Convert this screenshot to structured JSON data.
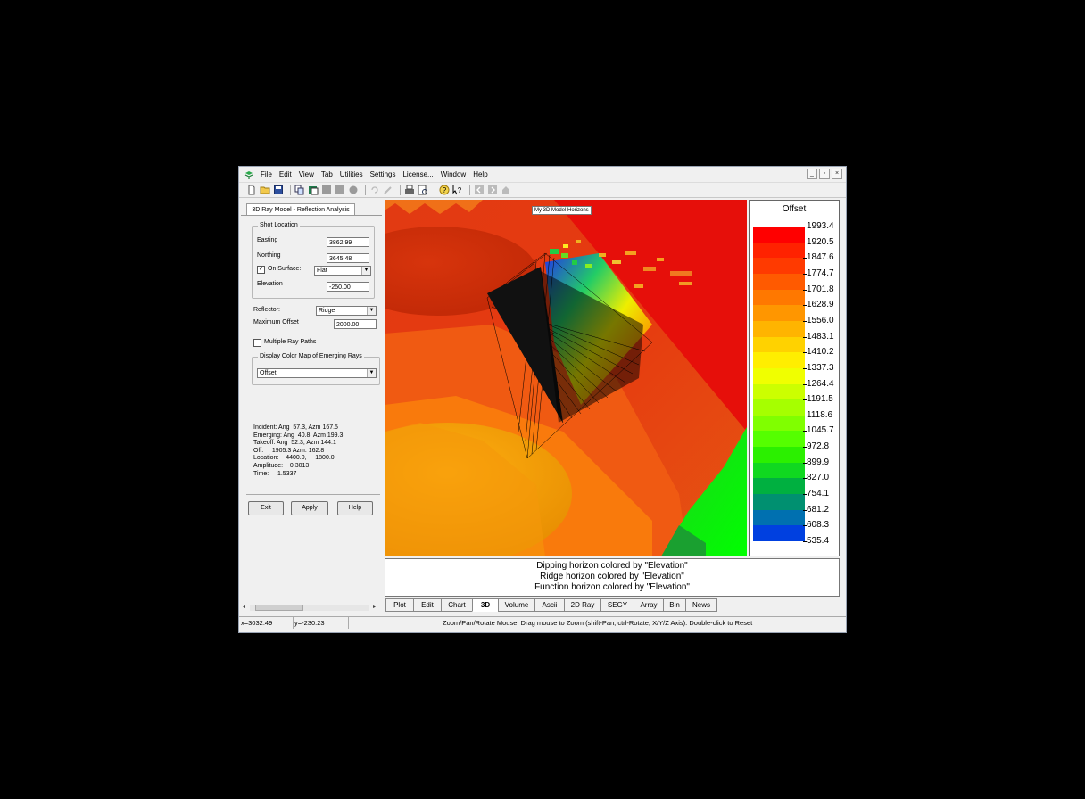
{
  "menu": [
    "File",
    "Edit",
    "View",
    "Tab",
    "Utilities",
    "Settings",
    "License...",
    "Window",
    "Help"
  ],
  "window_controls": [
    "_",
    "▫",
    "×"
  ],
  "panel": {
    "tab_label": "3D Ray Model - Reflection Analysis",
    "shot_group_title": "Shot Location",
    "easting_label": "Easting",
    "easting_value": "3862.99",
    "northing_label": "Northing",
    "northing_value": "3645.48",
    "on_surface_label": "On Surface:",
    "on_surface_checked": "✓",
    "on_surface_value": "Flat",
    "elevation_label": "Elevation",
    "elevation_value": "-250.00",
    "reflector_label": "Reflector:",
    "reflector_value": "Ridge",
    "max_offset_label": "Maximum Offset",
    "max_offset_value": "2000.00",
    "multiple_ray_label": "Multiple Ray Paths",
    "color_map_group_title": "Display Color Map of Emerging Rays",
    "color_map_value": "Offset",
    "info_lines": [
      "Incident: Ang  57.3, Azm 167.5",
      "Emerging: Ang  40.8, Azm 199.3",
      "Takeoff: Ang  52.3, Azm 144.1",
      "Off:     1905.3 Azm: 162.8",
      "Location:    4400.0,     1800.0",
      "Amplitude:    0.3013",
      "Time:     1.5337"
    ],
    "exit_label": "Exit",
    "apply_label": "Apply",
    "help_label": "Help"
  },
  "plot": {
    "title": "My 3D Model Horizons"
  },
  "legend": {
    "title": "Offset",
    "ticks": [
      "1993.4",
      "1920.5",
      "1847.6",
      "1774.7",
      "1701.8",
      "1628.9",
      "1556.0",
      "1483.1",
      "1410.2",
      "1337.3",
      "1264.4",
      "1191.5",
      "1118.6",
      "1045.7",
      "972.8",
      "899.9",
      "827.0",
      "754.1",
      "681.2",
      "608.3",
      "535.4"
    ],
    "colors": [
      "#ff0000",
      "#ff2200",
      "#ff3a00",
      "#ff5a00",
      "#ff7800",
      "#ff9600",
      "#ffb400",
      "#ffd200",
      "#ffee00",
      "#f0ff00",
      "#ccff00",
      "#a6ff00",
      "#80ff00",
      "#55ff00",
      "#2bf000",
      "#10d820",
      "#00b040",
      "#009070",
      "#0070b0",
      "#0040e0",
      "#0000ff"
    ]
  },
  "notes": [
    "Dipping horizon colored by \"Elevation\"",
    "Ridge horizon colored by \"Elevation\"",
    "Function horizon colored by \"Elevation\""
  ],
  "tabs": [
    "Plot",
    "Edit",
    "Chart",
    "3D",
    "Volume",
    "Ascii",
    "2D Ray",
    "SEGY",
    "Array",
    "Bin",
    "News"
  ],
  "active_tab": "3D",
  "status": {
    "x": "x=3032.49",
    "y": "y=-230.23",
    "message": "Zoom/Pan/Rotate Mouse: Drag mouse to Zoom (shift-Pan, ctrl-Rotate, X/Y/Z Axis). Double-click to Reset"
  }
}
